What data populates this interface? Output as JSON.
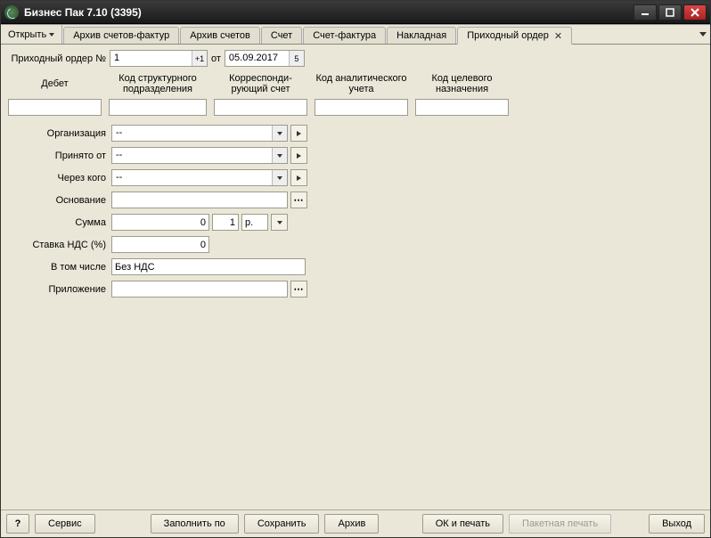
{
  "window": {
    "title": "Бизнес Пак 7.10 (3395)"
  },
  "toolbar": {
    "open_label": "Открыть"
  },
  "tabs": [
    {
      "label": "Архив счетов-фактур",
      "active": false,
      "closable": false
    },
    {
      "label": "Архив счетов",
      "active": false,
      "closable": false
    },
    {
      "label": "Счет",
      "active": false,
      "closable": false
    },
    {
      "label": "Счет-фактура",
      "active": false,
      "closable": false
    },
    {
      "label": "Накладная",
      "active": false,
      "closable": false
    },
    {
      "label": "Приходный ордер",
      "active": true,
      "closable": true
    }
  ],
  "doc": {
    "number_label": "Приходный ордер №",
    "number_value": "1",
    "number_plus": "+1",
    "from_label": "от",
    "date_value": "05.09.2017",
    "date_day": "5"
  },
  "headers": {
    "debet": "Дебет",
    "kod_struct": "Код структурного подразделения",
    "korr": "Корреспонди­рующий счет",
    "kod_anal": "Код аналитичес­кого учета",
    "kod_cel": "Код целевого назначения"
  },
  "fields": {
    "org_label": "Организация",
    "org_value": "--",
    "accepted_from_label": "Принято от",
    "accepted_from_value": "--",
    "through_label": "Через кого",
    "through_value": "--",
    "reason_label": "Основание",
    "reason_value": "",
    "sum_label": "Сумма",
    "sum_value": "0",
    "sum_qty": "1",
    "sum_unit": "р.",
    "vat_rate_label": "Ставка НДС (%)",
    "vat_rate_value": "0",
    "incl_label": "В том числе",
    "incl_value": "Без НДС",
    "attach_label": "Приложение",
    "attach_value": ""
  },
  "footer": {
    "help": "?",
    "service": "Сервис",
    "fill_by": "Заполнить по",
    "save": "Сохранить",
    "archive": "Архив",
    "ok_print": "ОК и печать",
    "batch_print": "Пакетная печать",
    "exit": "Выход"
  }
}
